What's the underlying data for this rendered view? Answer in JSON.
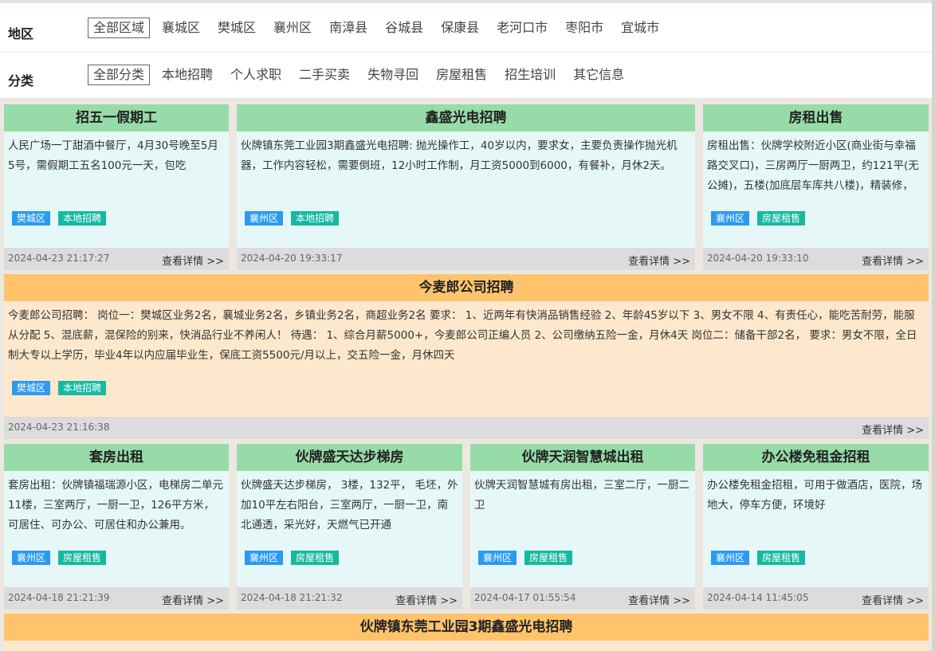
{
  "filters": {
    "region_label": "地区",
    "regions": [
      "全部区域",
      "襄城区",
      "樊城区",
      "襄州区",
      "南漳县",
      "谷城县",
      "保康县",
      "老河口市",
      "枣阳市",
      "宜城市"
    ],
    "category_label": "分类",
    "categories": [
      "全部分类",
      "本地招聘",
      "个人求职",
      "二手买卖",
      "失物寻回",
      "房屋租售",
      "招生培训",
      "其它信息"
    ]
  },
  "more_label": "查看详情 >>",
  "cards": [
    {
      "title": "招五一假期工",
      "text": "人民广场一丁甜酒中餐厅，4月30号晚至5月5号，需假期工五名100元一天，包吃",
      "location": "樊城区",
      "category": "本地招聘",
      "time": "2024-04-23 21:17:27"
    },
    {
      "title": "鑫盛光电招聘",
      "text": "伙牌镇东莞工业园3期鑫盛光电招聘: 抛光操作工，40岁以内，要求女，主要负责操作抛光机器，工作内容轻松，需要倒班，12小时工作制，月工资5000到6000，有餐补，月休2天。",
      "location": "襄州区",
      "category": "本地招聘",
      "time": "2024-04-20 19:33:17"
    },
    {
      "title": "房租出售",
      "text": "房租出售：伙牌学校附近小区(商业街与幸福路交叉口)，三房两厅一厨两卫，约121平(无公摊)，五楼(加底层车库共八楼)，精装修，",
      "location": "襄州区",
      "category": "房屋租售",
      "time": "2024-04-20 19:33:10"
    },
    {
      "title": "今麦郎公司招聘",
      "text": "今麦郎公司招聘： 岗位一：樊城区业务2名，襄城业务2名，乡镇业务2名，商超业务2名 要求： 1、近两年有快消品销售经验 2、年龄45岁以下 3、男女不限 4、有责任心，能吃苦耐劳，能服从分配 5、混底薪，混保险的别来，快消品行业不养闲人！ 待遇： 1、综合月薪5000+，今麦郎公司正编人员 2、公司缴纳五险一金，月休4天 岗位二：储备干部2名， 要求：男女不限，全日制大专以上学历，毕业4年以内应届毕业生，保底工资5500元/月以上，交五险一金，月休四天",
      "location": "樊城区",
      "category": "本地招聘",
      "time": "2024-04-23 21:16:38"
    },
    {
      "title": "套房出租",
      "text": "套房出租：伙牌镇福瑞源小区，电梯房二单元11楼，三室两厅，一厨一卫，126平方米，可居住、可办公、可居住和办公兼用。",
      "location": "襄州区",
      "category": "房屋租售",
      "time": "2024-04-18 21:21:39"
    },
    {
      "title": "伙牌盛天达步梯房",
      "text": "伙牌盛天达步梯房， 3楼，132平， 毛坯，外加10平左右阳台，三室两厅，一厨一卫，南北通透，采光好，天燃气已开通",
      "location": "襄州区",
      "category": "房屋租售",
      "time": "2024-04-18 21:21:32"
    },
    {
      "title": "伙牌天润智慧城出租",
      "text": "伙牌天润智慧城有房出租，三室二厅，一厨二卫",
      "location": "襄州区",
      "category": "房屋租售",
      "time": "2024-04-17 01:55:54"
    },
    {
      "title": "办公楼免租金招租",
      "text": "办公楼免租金招租，可用于做酒店，医院，场地大，停车方便，环境好",
      "location": "襄州区",
      "category": "房屋租售",
      "time": "2024-04-14 11:45:05"
    },
    {
      "title": "伙牌镇东莞工业园3期鑫盛光电招聘"
    }
  ],
  "colors": {
    "green_header": "#97dba8",
    "orange_header": "#ffc46b",
    "card_body": "#e6f7f8",
    "wide_body": "#fde8cd",
    "tag_location": "#2a9af2",
    "tag_category": "#16b9a0",
    "footer": "#dcdcdc"
  }
}
